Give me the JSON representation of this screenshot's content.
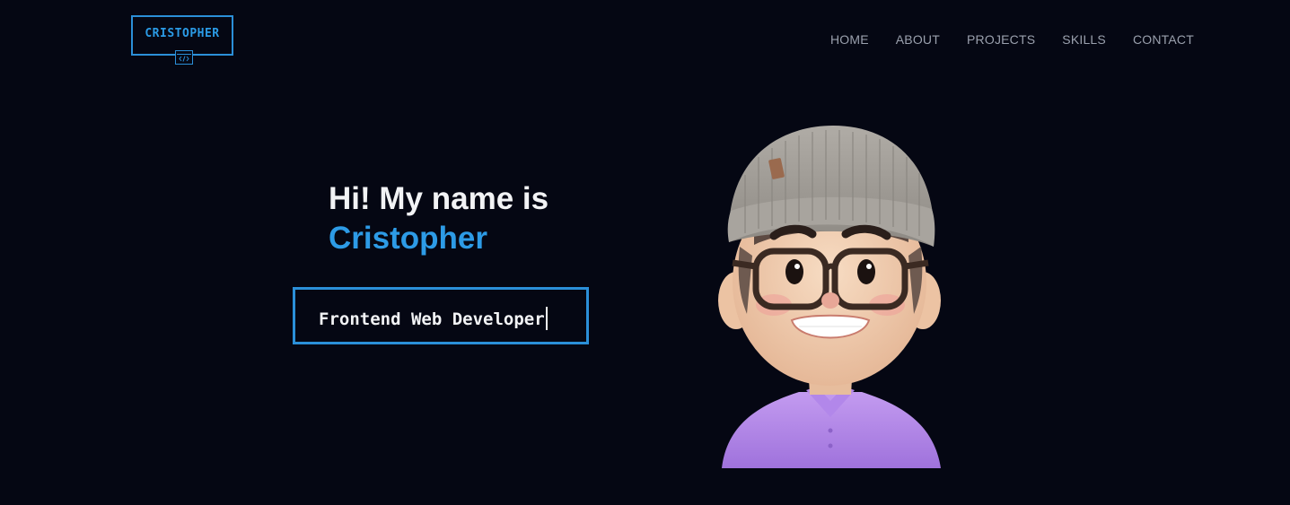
{
  "logo": {
    "text": "CRISTOPHER",
    "icon": "code-brackets-icon"
  },
  "nav": {
    "items": [
      {
        "label": "HOME"
      },
      {
        "label": "ABOUT"
      },
      {
        "label": "PROJECTS"
      },
      {
        "label": "SKILLS"
      },
      {
        "label": "CONTACT"
      }
    ]
  },
  "hero": {
    "greeting": "Hi! My name is",
    "name": "Cristopher",
    "role": "Frontend Web Developer"
  },
  "avatar": {
    "icon": "3d-avatar-illustration"
  },
  "colors": {
    "background": "#050713",
    "accent": "#2b8fd8",
    "name": "#2d9be6",
    "text": "#f2f3f5",
    "nav": "#9aa0ad"
  }
}
